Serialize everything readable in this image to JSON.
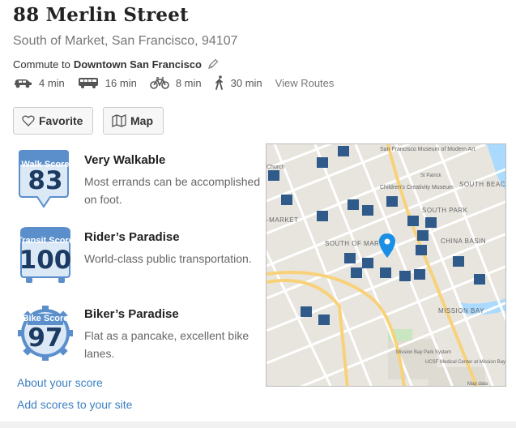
{
  "address": {
    "title": "88 Merlin Street",
    "subtitle": "South of Market, San Francisco, 94107"
  },
  "commute": {
    "prefix": "Commute to",
    "destination": "Downtown San Francisco",
    "edit_icon": "pencil-icon"
  },
  "modes": [
    {
      "icon": "car-icon",
      "label": "4 min"
    },
    {
      "icon": "bus-icon",
      "label": "16 min"
    },
    {
      "icon": "bike-icon",
      "label": "8 min"
    },
    {
      "icon": "walk-icon",
      "label": "30 min"
    }
  ],
  "view_routes": "View Routes",
  "buttons": {
    "favorite": "Favorite",
    "map": "Map"
  },
  "scores": [
    {
      "kind": "Walk Score",
      "value": "83",
      "title": "Very Walkable",
      "desc": "Most errands can be accomplished on foot.",
      "color": "#5b8fcc"
    },
    {
      "kind": "Transit Score",
      "value": "100",
      "title": "Rider’s Paradise",
      "desc": "World-class public transportation.",
      "color": "#5b8fcc"
    },
    {
      "kind": "Bike Score",
      "value": "97",
      "title": "Biker’s Paradise",
      "desc": "Flat as a pancake, excellent bike lanes.",
      "color": "#5b8fcc"
    }
  ],
  "links": {
    "about": "About your score",
    "add": "Add scores to your site"
  },
  "map": {
    "labels": {
      "museum": "San Francisco Museum of Modern Art",
      "childrens": "Children's Creativity Museum",
      "south_beach": "SOUTH BEACH",
      "south_park": "SOUTH PARK",
      "china_basin": "CHINA BASIN",
      "south_of_market": "SOUTH OF MARKET",
      "market": "-MARKET",
      "mission_bay": "MISSION BAY",
      "mission_bay_park": "Mission Bay Park System",
      "ucsf": "UCSF Medical Center at Mission Bay",
      "church": "Church",
      "st_patrick": "St Patrick",
      "map_data": "Map data"
    }
  }
}
